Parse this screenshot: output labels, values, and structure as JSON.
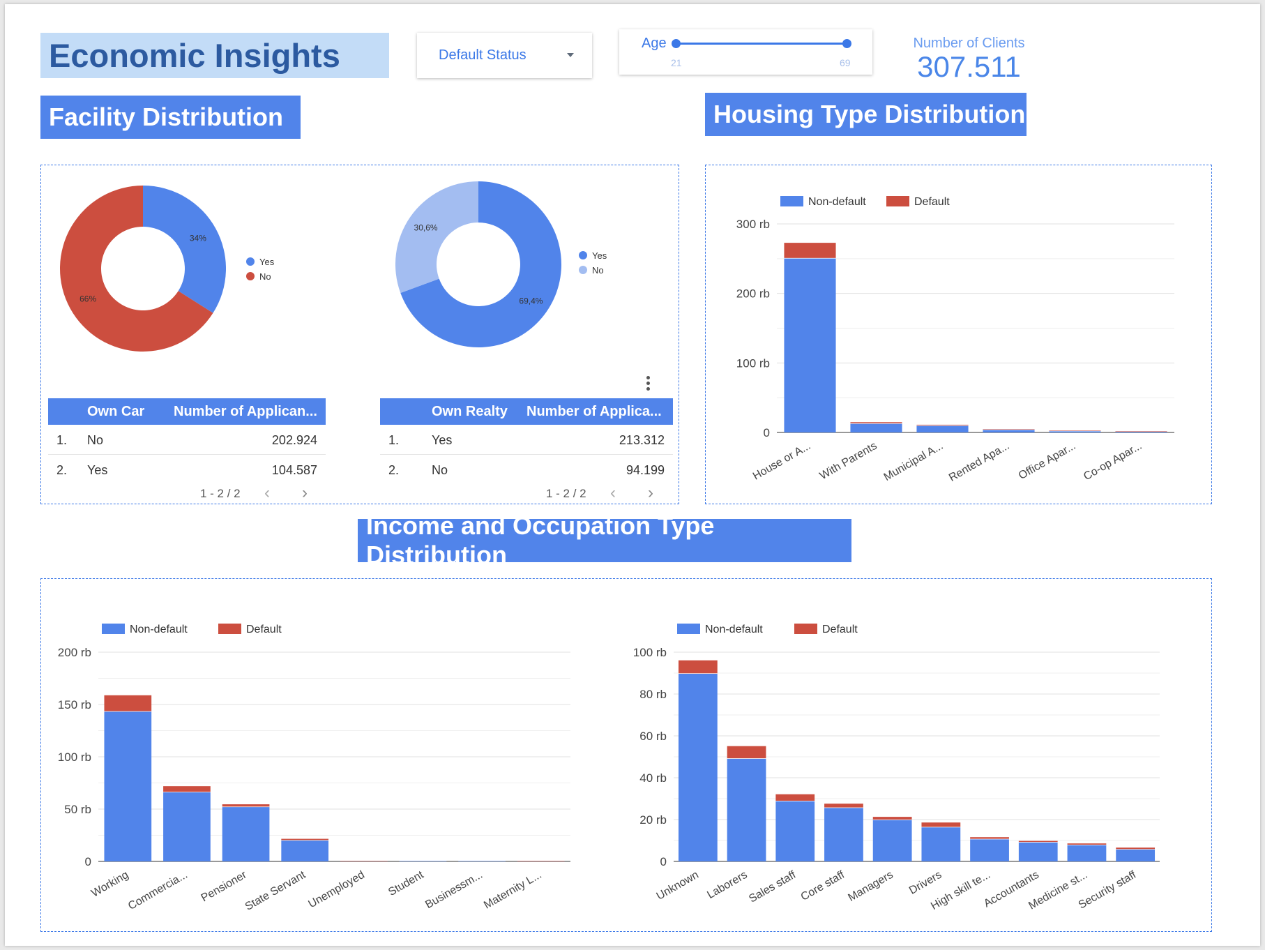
{
  "header": {
    "title": "Economic Insights",
    "filter": {
      "label": "Default Status"
    },
    "age": {
      "label": "Age",
      "min": "21",
      "max": "69"
    },
    "kpi": {
      "label": "Number of Clients",
      "value": "307.511"
    }
  },
  "sections": {
    "facility": "Facility Distribution",
    "housing": "Housing Type Distribution",
    "income": "Income and Occupation Type Distribution"
  },
  "colors": {
    "nondefault": "#5184ea",
    "default": "#cc4e3f",
    "light": "#a3bdf1"
  },
  "car_table": {
    "headers": [
      "Own Car",
      "Number of Applican..."
    ],
    "rows": [
      {
        "idx": "1.",
        "label": "No",
        "value": "202.924"
      },
      {
        "idx": "2.",
        "label": "Yes",
        "value": "104.587"
      }
    ],
    "pager": "1 - 2 / 2"
  },
  "realty_table": {
    "headers": [
      "Own Realty",
      "Number of Applica..."
    ],
    "rows": [
      {
        "idx": "1.",
        "label": "Yes",
        "value": "213.312"
      },
      {
        "idx": "2.",
        "label": "No",
        "value": "94.199"
      }
    ],
    "pager": "1 - 2 / 2"
  },
  "chart_data": [
    {
      "id": "car",
      "type": "pie",
      "categories": [
        "Yes",
        "No"
      ],
      "values": [
        34,
        66
      ],
      "labels": [
        "34%",
        "66%"
      ],
      "colors": [
        "#5184ea",
        "#cc4e3f"
      ]
    },
    {
      "id": "realty",
      "type": "pie",
      "categories": [
        "Yes",
        "No"
      ],
      "values": [
        69.4,
        30.6
      ],
      "labels": [
        "69,4%",
        "30,6%"
      ],
      "colors": [
        "#5184ea",
        "#a3bdf1"
      ]
    },
    {
      "id": "housing",
      "type": "bar",
      "stacked": true,
      "categories": [
        "House or A...",
        "With Parents",
        "Municipal A...",
        "Rented Apa...",
        "Office Apar...",
        "Co-op Apar..."
      ],
      "series": [
        {
          "name": "Non-default",
          "values": [
            251,
            13.2,
            10.2,
            4.3,
            2.4,
            1.0
          ]
        },
        {
          "name": "Default",
          "values": [
            21.8,
            1.6,
            0.9,
            0.6,
            0.2,
            0.1
          ]
        }
      ],
      "ylim": [
        0,
        300
      ],
      "yticks": [
        "0",
        "100 rb",
        "200 rb",
        "300 rb"
      ],
      "legend": "top-left",
      "grid": true
    },
    {
      "id": "income",
      "type": "bar",
      "stacked": true,
      "categories": [
        "Working",
        "Commercia...",
        "Pensioner",
        "State Servant",
        "Unemployed",
        "Student",
        "Businessm...",
        "Maternity L..."
      ],
      "series": [
        {
          "name": "Non-default",
          "values": [
            143.6,
            66.5,
            52.4,
            20.4,
            0.014,
            0.018,
            0.01,
            0.003
          ]
        },
        {
          "name": "Default",
          "values": [
            15.2,
            5.4,
            2.2,
            1.2,
            0.008,
            0,
            0,
            0.002
          ]
        }
      ],
      "ylim": [
        0,
        200
      ],
      "yticks": [
        "0",
        "50 rb",
        "100 rb",
        "150 rb",
        "200 rb"
      ],
      "legend": "top-left",
      "grid": true
    },
    {
      "id": "occupation",
      "type": "bar",
      "stacked": true,
      "categories": [
        "Unknown",
        "Laborers",
        "Sales staff",
        "Core staff",
        "Managers",
        "Drivers",
        "High skill te...",
        "Accountants",
        "Medicine st...",
        "Security staff"
      ],
      "series": [
        {
          "name": "Non-default",
          "values": [
            89.9,
            49.3,
            29.0,
            25.8,
            20.0,
            16.5,
            10.8,
            9.3,
            8.0,
            5.9
          ]
        },
        {
          "name": "Default",
          "values": [
            6.2,
            5.8,
            3.1,
            1.8,
            1.3,
            2.1,
            0.8,
            0.5,
            0.6,
            0.7
          ]
        }
      ],
      "ylim": [
        0,
        100
      ],
      "yticks": [
        "0",
        "20 rb",
        "40 rb",
        "60 rb",
        "80 rb",
        "100 rb"
      ],
      "legend": "top-left",
      "grid": true
    }
  ],
  "legend": {
    "nondefault": "Non-default",
    "default": "Default"
  }
}
